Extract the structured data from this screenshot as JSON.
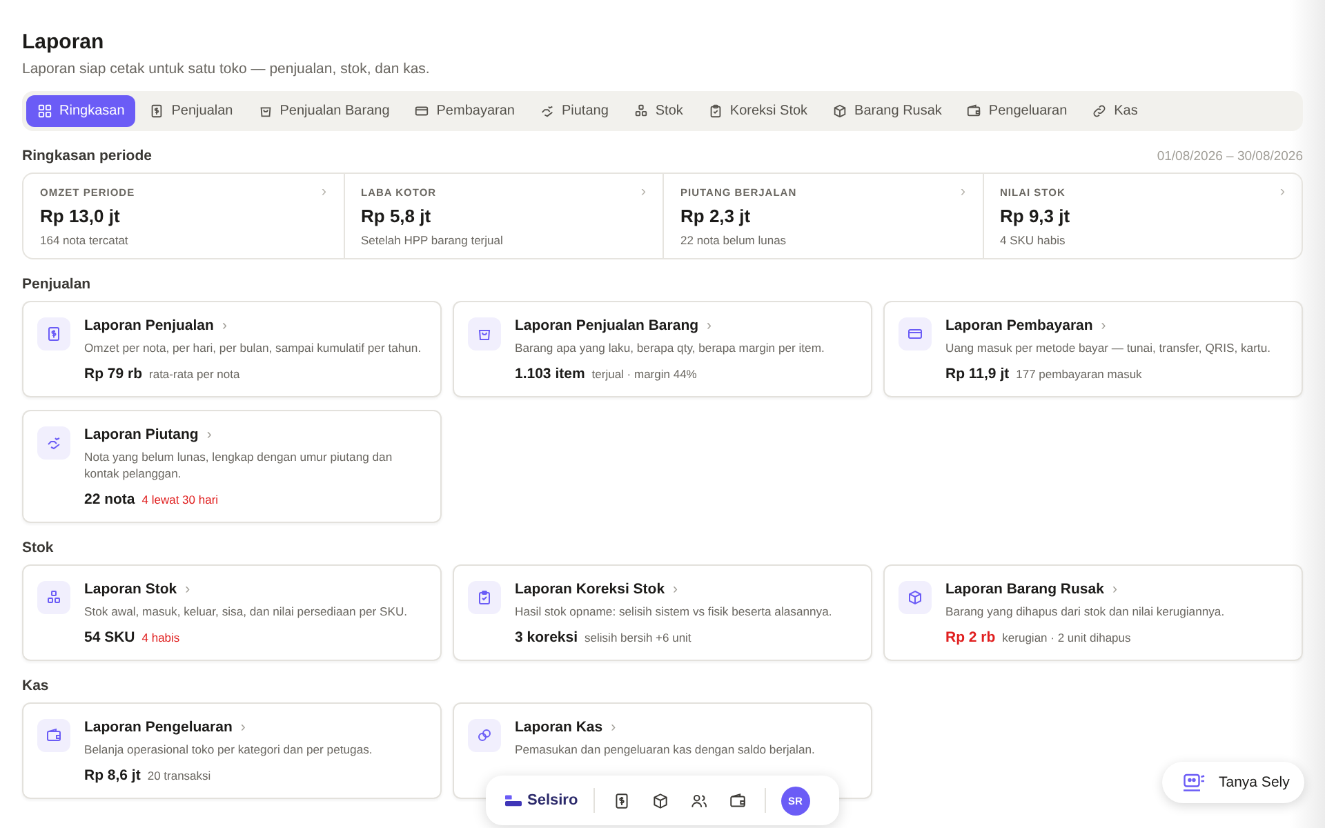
{
  "header": {
    "title": "Laporan",
    "subtitle": "Laporan siap cetak untuk satu toko — penjualan, stok, dan kas."
  },
  "tabs": [
    {
      "label": "Ringkasan",
      "selected": true
    },
    {
      "label": "Penjualan",
      "selected": false
    },
    {
      "label": "Penjualan Barang",
      "selected": false
    },
    {
      "label": "Pembayaran",
      "selected": false
    },
    {
      "label": "Piutang",
      "selected": false
    },
    {
      "label": "Stok",
      "selected": false
    },
    {
      "label": "Koreksi Stok",
      "selected": false
    },
    {
      "label": "Barang Rusak",
      "selected": false
    },
    {
      "label": "Pengeluaran",
      "selected": false
    },
    {
      "label": "Kas",
      "selected": false
    }
  ],
  "summary": {
    "title": "Ringkasan periode",
    "period": "01/08/2026 – 30/08/2026",
    "chevron": "›",
    "metrics": [
      {
        "label": "OMZET PERIODE",
        "value": "Rp 13,0 jt",
        "note": "164 nota tercatat"
      },
      {
        "label": "LABA KOTOR",
        "value": "Rp 5,8 jt",
        "note": "Setelah HPP barang terjual"
      },
      {
        "label": "PIUTANG BERJALAN",
        "value": "Rp 2,3 jt",
        "note": "22 nota belum lunas"
      },
      {
        "label": "NILAI STOK",
        "value": "Rp 9,3 jt",
        "note": "4 SKU habis"
      }
    ]
  },
  "sections": [
    {
      "title": "Penjualan",
      "reports": [
        {
          "title": "Laporan Penjualan",
          "desc": "Omzet per nota, per hari, per bulan, sampai kumulatif per tahun.",
          "value": "Rp 79 rb",
          "value_alert": false,
          "note": "rata-rata per nota",
          "note_alert": false
        },
        {
          "title": "Laporan Penjualan Barang",
          "desc": "Barang apa yang laku, berapa qty, berapa margin per item.",
          "value": "1.103 item",
          "value_alert": false,
          "note": "terjual · margin 44%",
          "note_alert": false
        },
        {
          "title": "Laporan Pembayaran",
          "desc": "Uang masuk per metode bayar — tunai, transfer, QRIS, kartu.",
          "value": "Rp 11,9 jt",
          "value_alert": false,
          "note": "177 pembayaran masuk",
          "note_alert": false
        },
        {
          "title": "Laporan Piutang",
          "desc": "Nota yang belum lunas, lengkap dengan umur piutang dan kontak pelanggan.",
          "value": "22 nota",
          "value_alert": false,
          "note": "4 lewat 30 hari",
          "note_alert": true
        }
      ]
    },
    {
      "title": "Stok",
      "reports": [
        {
          "title": "Laporan Stok",
          "desc": "Stok awal, masuk, keluar, sisa, dan nilai persediaan per SKU.",
          "value": "54 SKU",
          "value_alert": false,
          "note": "4 habis",
          "note_alert": true
        },
        {
          "title": "Laporan Koreksi Stok",
          "desc": "Hasil stok opname: selisih sistem vs fisik beserta alasannya.",
          "value": "3 koreksi",
          "value_alert": false,
          "note": "selisih bersih +6 unit",
          "note_alert": false
        },
        {
          "title": "Laporan Barang Rusak",
          "desc": "Barang yang dihapus dari stok dan nilai kerugiannya.",
          "value": "Rp 2 rb",
          "value_alert": true,
          "note": "kerugian · 2 unit dihapus",
          "note_alert": false
        }
      ]
    },
    {
      "title": "Kas",
      "reports": [
        {
          "title": "Laporan Pengeluaran",
          "desc": "Belanja operasional toko per kategori dan per petugas.",
          "value": "Rp 8,6 jt",
          "value_alert": false,
          "note": "20 transaksi",
          "note_alert": false
        },
        {
          "title": "Laporan Kas",
          "desc": "Pemasukan dan pengeluaran kas dengan saldo berjalan."
        }
      ]
    }
  ],
  "dock": {
    "brand": "Selsiro",
    "avatar": "SR"
  },
  "assistant": {
    "label": "Tanya Sely"
  }
}
